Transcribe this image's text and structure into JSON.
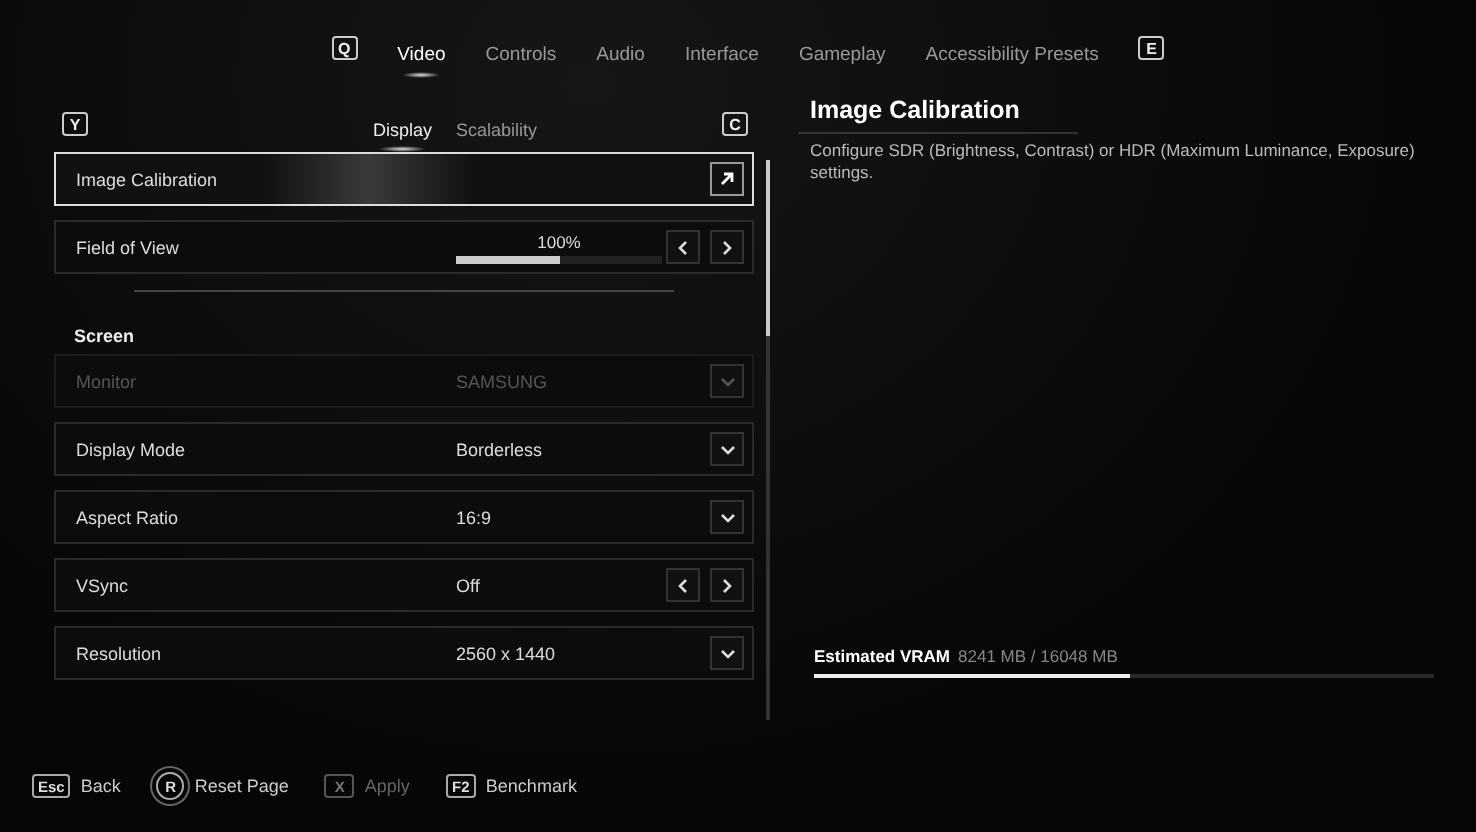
{
  "top_tabs": {
    "prev_key": "Q",
    "next_key": "E",
    "items": [
      {
        "label": "Video",
        "selected": true
      },
      {
        "label": "Controls",
        "selected": false
      },
      {
        "label": "Audio",
        "selected": false
      },
      {
        "label": "Interface",
        "selected": false
      },
      {
        "label": "Gameplay",
        "selected": false
      },
      {
        "label": "Accessibility Presets",
        "selected": false
      }
    ]
  },
  "sub_tabs": {
    "prev_key": "Y",
    "next_key": "C",
    "items": [
      {
        "label": "Display",
        "selected": true
      },
      {
        "label": "Scalability",
        "selected": false
      }
    ]
  },
  "settings": [
    {
      "kind": "link",
      "label": "Image Calibration",
      "selected": true,
      "disabled": false
    },
    {
      "kind": "slider",
      "label": "Field of View",
      "reading": "100%",
      "level": 0.5,
      "selected": false,
      "disabled": false
    },
    {
      "kind": "heading",
      "label": "Screen"
    },
    {
      "kind": "dropdown",
      "label": "Monitor",
      "value": "SAMSUNG",
      "selected": false,
      "disabled": true
    },
    {
      "kind": "dropdown",
      "label": "Display Mode",
      "value": "Borderless",
      "selected": false,
      "disabled": false
    },
    {
      "kind": "dropdown",
      "label": "Aspect Ratio",
      "value": "16:9",
      "selected": false,
      "disabled": false
    },
    {
      "kind": "stepper",
      "label": "VSync",
      "value": "Off",
      "selected": false,
      "disabled": false
    },
    {
      "kind": "dropdown",
      "label": "Resolution",
      "value": "2560 x 1440",
      "selected": false,
      "disabled": false
    }
  ],
  "details": {
    "title": "Image Calibration",
    "description": "Configure SDR (Brightness, Contrast) or HDR (Maximum Luminance, Exposure) settings."
  },
  "vram": {
    "label": "Estimated VRAM",
    "reading": "8241 MB / 16048 MB",
    "level": 0.51
  },
  "footer": [
    {
      "kind": "square",
      "key": "Esc",
      "label": "Back",
      "disabled": false
    },
    {
      "kind": "circle",
      "key": "R",
      "label": "Reset Page",
      "disabled": false
    },
    {
      "kind": "square",
      "key": "X",
      "label": "Apply",
      "disabled": true
    },
    {
      "kind": "square",
      "key": "F2",
      "label": "Benchmark",
      "disabled": false
    }
  ]
}
